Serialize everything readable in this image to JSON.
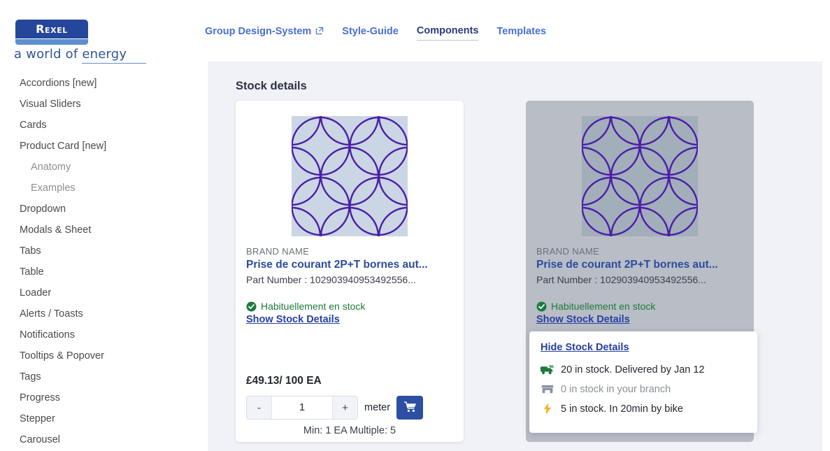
{
  "brand": {
    "logo_text": "Rexel",
    "tagline_prefix": "a world of ",
    "tagline_underlined": "energy",
    "logo_bg": "#24469b",
    "logo_bar": "#5c8ed0"
  },
  "topnav": {
    "items": [
      {
        "label": "Group Design-System",
        "external": true,
        "active": false
      },
      {
        "label": "Style-Guide",
        "external": false,
        "active": false
      },
      {
        "label": "Components",
        "external": false,
        "active": true
      },
      {
        "label": "Templates",
        "external": false,
        "active": false
      }
    ]
  },
  "sidebar": {
    "items": [
      {
        "label": "Accordions [new]",
        "sub": false
      },
      {
        "label": "Visual Sliders",
        "sub": false
      },
      {
        "label": "Cards",
        "sub": false
      },
      {
        "label": "Product Card [new]",
        "sub": false
      },
      {
        "label": "Anatomy",
        "sub": true
      },
      {
        "label": "Examples",
        "sub": true
      },
      {
        "label": "Dropdown",
        "sub": false
      },
      {
        "label": "Modals & Sheet",
        "sub": false
      },
      {
        "label": "Tabs",
        "sub": false
      },
      {
        "label": "Table",
        "sub": false
      },
      {
        "label": "Loader",
        "sub": false
      },
      {
        "label": "Alerts / Toasts",
        "sub": false
      },
      {
        "label": "Notifications",
        "sub": false
      },
      {
        "label": "Tooltips & Popover",
        "sub": false
      },
      {
        "label": "Tags",
        "sub": false
      },
      {
        "label": "Progress",
        "sub": false
      },
      {
        "label": "Stepper",
        "sub": false
      },
      {
        "label": "Carousel",
        "sub": false
      }
    ]
  },
  "panel": {
    "title": "Stock details"
  },
  "cards": [
    {
      "brand_name": "BRAND NAME",
      "product_name": "Prise de courant 2P+T bornes aut...",
      "part_number": "Part Number : 102903940953492556...",
      "stock_status": "Habituellement en stock",
      "stock_link": "Show Stock Details",
      "price": "£49.13/ 100 EA",
      "qty_minus": "-",
      "qty_value": "1",
      "qty_plus": "+",
      "unit": "meter",
      "cart_icon": "shopping-cart-icon",
      "min_line": "Min: 1 EA Multiple: 5"
    },
    {
      "brand_name": "BRAND NAME",
      "product_name": "Prise de courant 2P+T bornes aut...",
      "part_number": "Part Number : 102903940953492556...",
      "stock_status": "Habituellement en stock",
      "stock_link": "Show Stock Details"
    }
  ],
  "popover": {
    "hide_link": "Hide Stock Details",
    "rows": [
      {
        "icon": "delivery-truck-icon",
        "text": "20 in stock. Delivered by Jan 12",
        "color": "#1f7a3d"
      },
      {
        "icon": "store-icon",
        "text": "0 in stock in your branch",
        "color": "#8b8f98"
      },
      {
        "icon": "lightning-bolt-icon",
        "text": "5 in stock. In 20min by bike",
        "color": "#f2b21a"
      }
    ]
  },
  "colors": {
    "accent_blue": "#2d4b9e",
    "nav_blue": "#4a6fd4",
    "panel_bg": "#f1f2f7",
    "success_green": "#1f7a3d",
    "pattern_purple": "#4b1fa8",
    "pattern_bg_light": "#cbd6e4",
    "pattern_bg_dim": "#a2aeba",
    "card_dim_bg": "#b8bdc6"
  }
}
